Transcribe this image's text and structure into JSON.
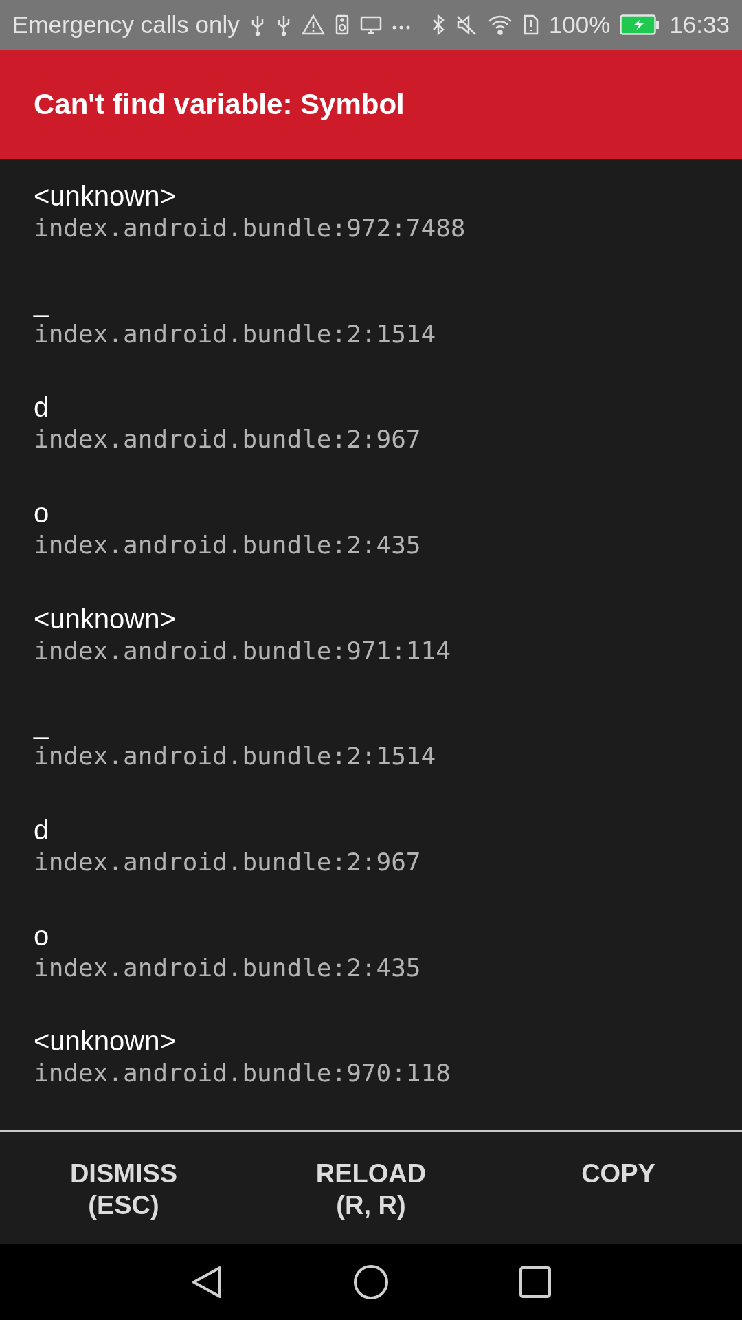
{
  "status_bar": {
    "carrier": "Emergency calls only",
    "battery": "100%",
    "time": "16:33"
  },
  "error": {
    "title": "Can't find variable: Symbol"
  },
  "frames": [
    {
      "method": "<unknown>",
      "location": "index.android.bundle:972:7488"
    },
    {
      "method": "_",
      "location": "index.android.bundle:2:1514"
    },
    {
      "method": "d",
      "location": "index.android.bundle:2:967"
    },
    {
      "method": "o",
      "location": "index.android.bundle:2:435"
    },
    {
      "method": "<unknown>",
      "location": "index.android.bundle:971:114"
    },
    {
      "method": "_",
      "location": "index.android.bundle:2:1514"
    },
    {
      "method": "d",
      "location": "index.android.bundle:2:967"
    },
    {
      "method": "o",
      "location": "index.android.bundle:2:435"
    },
    {
      "method": "<unknown>",
      "location": "index.android.bundle:970:118"
    }
  ],
  "buttons": [
    {
      "label": "DISMISS",
      "shortcut": "(ESC)"
    },
    {
      "label": "RELOAD",
      "shortcut": "(R, R)"
    },
    {
      "label": "COPY"
    }
  ]
}
